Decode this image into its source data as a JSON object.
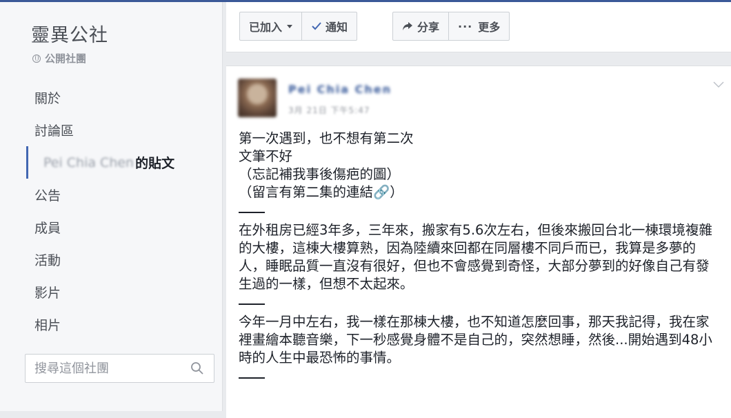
{
  "sidebar": {
    "group_name": "靈異公社",
    "group_type": "公開社團",
    "nav_items": [
      {
        "label": "關於"
      },
      {
        "label": "討論區"
      },
      {
        "label_blurred": "Pei Chia Chen",
        "label_suffix": "的貼文"
      },
      {
        "label": "公告"
      },
      {
        "label": "成員"
      },
      {
        "label": "活動"
      },
      {
        "label": "影片"
      },
      {
        "label": "相片"
      }
    ],
    "search_placeholder": "搜尋這個社團"
  },
  "actionbar": {
    "joined_label": "已加入",
    "notify_label": "通知",
    "share_label": "分享",
    "more_dots": "···",
    "more_label": "更多"
  },
  "post": {
    "author": "Pei Chia Chen",
    "time": "3月 21日 下午5:47",
    "intro_lines": [
      "第一次遇到，也不想有第二次",
      "文筆不好",
      "（忘記補我事後傷疤的圖）",
      "（留言有第二集的連結🔗）"
    ],
    "paragraph1": "在外租房已經3年多，三年來，搬家有5.6次左右，但後來搬回台北一棟環境複雜的大樓，這棟大樓算熟，因為陸續來回都在同層樓不同戶而已，我算是多夢的人，睡眠品質一直沒有很好，但也不會感覺到奇怪，大部分夢到的好像自己有發生過的一樣，但想不太起來。",
    "paragraph2": "今年一月中左右，我一樣在那棟大樓，也不知道怎麼回事，那天我記得，我在家裡畫繪本聽音樂，下一秒感覺身體不是自己的，突然想睡，然後...開始遇到48小時的人生中最恐怖的事情。"
  },
  "colors": {
    "accent": "#4267b2",
    "link": "#365899",
    "background": "#e9ebee"
  }
}
